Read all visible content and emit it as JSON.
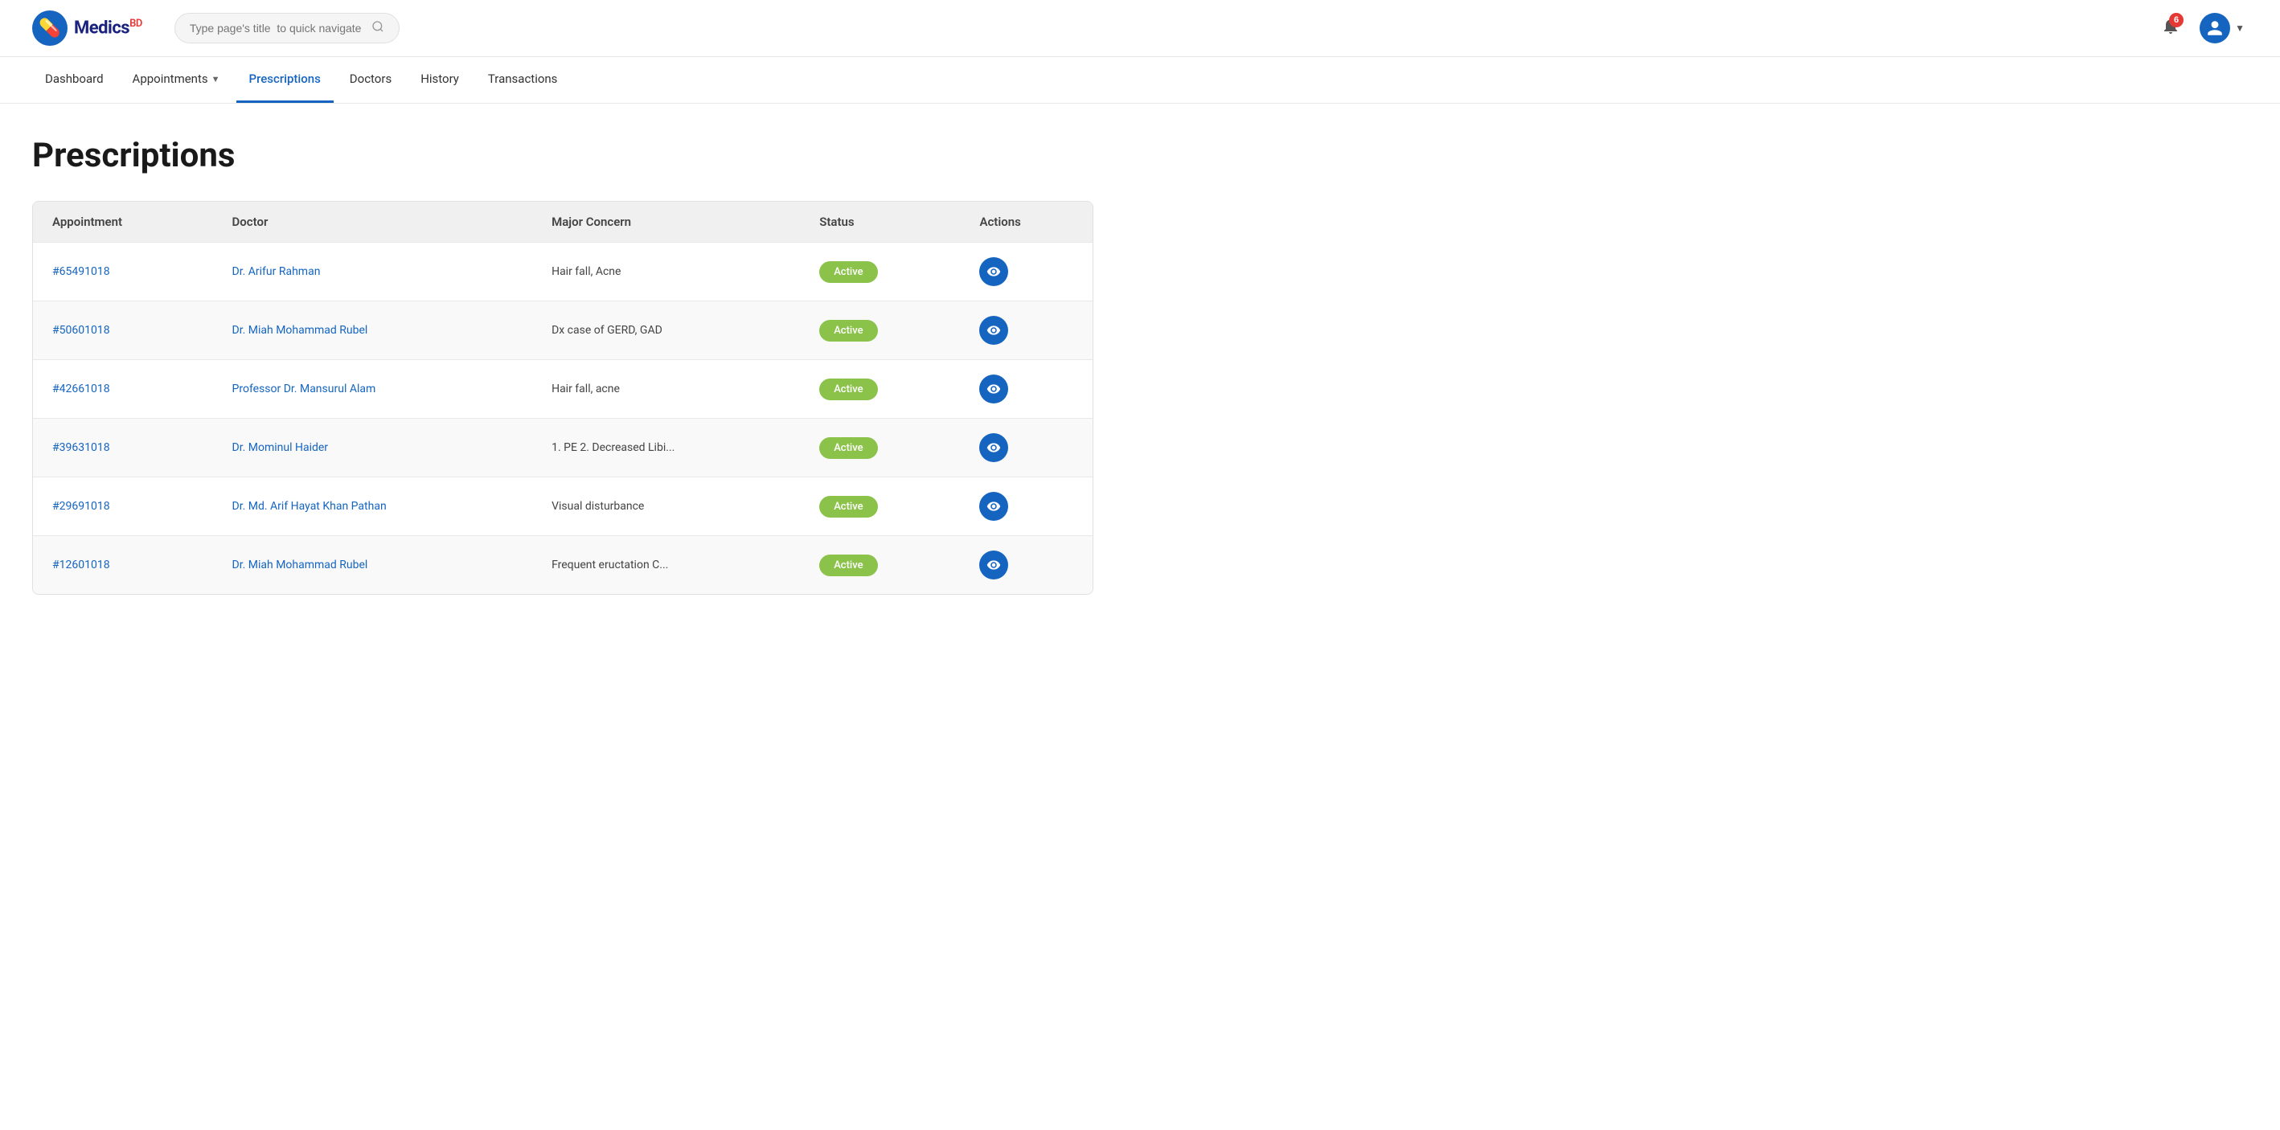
{
  "logo": {
    "text": "Medics",
    "sup": "BD"
  },
  "search": {
    "placeholder": "Type page's title  to quick navigate"
  },
  "notification": {
    "badge": "6"
  },
  "nav": {
    "items": [
      {
        "label": "Dashboard",
        "active": false,
        "hasDropdown": false
      },
      {
        "label": "Appointments",
        "active": false,
        "hasDropdown": true
      },
      {
        "label": "Prescriptions",
        "active": true,
        "hasDropdown": false
      },
      {
        "label": "Doctors",
        "active": false,
        "hasDropdown": false
      },
      {
        "label": "History",
        "active": false,
        "hasDropdown": false
      },
      {
        "label": "Transactions",
        "active": false,
        "hasDropdown": false
      }
    ]
  },
  "page": {
    "title": "Prescriptions"
  },
  "table": {
    "columns": [
      "Appointment",
      "Doctor",
      "Major Concern",
      "Status",
      "Actions"
    ],
    "rows": [
      {
        "appointment": "#65491018",
        "doctor": "Dr. Arifur Rahman",
        "majorConcern": "Hair fall, Acne",
        "status": "Active"
      },
      {
        "appointment": "#50601018",
        "doctor": "Dr. Miah Mohammad Rubel",
        "majorConcern": "Dx case of GERD, GAD",
        "status": "Active"
      },
      {
        "appointment": "#42661018",
        "doctor": "Professor Dr. Mansurul Alam",
        "majorConcern": "Hair fall, acne",
        "status": "Active"
      },
      {
        "appointment": "#39631018",
        "doctor": "Dr. Mominul Haider",
        "majorConcern": "1. PE 2. Decreased Libi...",
        "status": "Active"
      },
      {
        "appointment": "#29691018",
        "doctor": "Dr. Md. Arif Hayat Khan Pathan",
        "majorConcern": "Visual disturbance",
        "status": "Active"
      },
      {
        "appointment": "#12601018",
        "doctor": "Dr. Miah Mohammad Rubel",
        "majorConcern": "Frequent eructation C...",
        "status": "Active"
      }
    ]
  },
  "colors": {
    "active_badge": "#8bc34a",
    "action_btn": "#1565c0",
    "link": "#1565c0"
  }
}
